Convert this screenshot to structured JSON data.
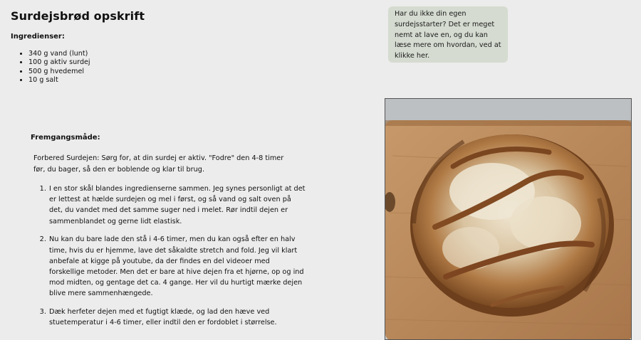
{
  "page": {
    "title": "Surdejsbrød opskrift"
  },
  "ingredients": {
    "heading": "Ingredienser:",
    "items": [
      "340 g vand (lunt)",
      "100 g aktiv surdej",
      "500 g hvedemel",
      "10 g salt"
    ]
  },
  "callout": {
    "text": "Har du ikke din egen surdejsstarter? Det er meget nemt at lave en, og du kan læse mere om hvordan, ved at klikke her."
  },
  "method": {
    "heading": "Fremgangsmåde:",
    "intro": "Forbered Surdejen: Sørg for, at din surdej er aktiv. \"Fodre\" den 4-8 timer før, du bager, så den er boblende og klar til brug.",
    "steps": [
      "I en stor skål blandes ingredienserne sammen. Jeg synes personligt at det er lettest at hælde surdejen og mel i først, og så vand og salt oven på det, du vandet med det samme suger ned i melet. Rør indtil dejen er sammenblandet og gerne lidt elastisk.",
      "Nu kan du bare lade den stå i 4-6 timer, men du kan også efter en halv time, hvis du er hjemme, lave det såkaldte stretch and fold. Jeg vil klart anbefale at kigge på youtube, da der findes en del videoer med forskellige metoder. Men det er bare at hive dejen fra et hjørne, op og ind mod midten, og gentage det ca. 4 gange. Her vil du hurtigt mærke dejen blive mere sammenhængede.",
      "Dæk herfeter dejen med et fugtigt klæde, og lad den hæve ved stuetemperatur i 4-6 timer, eller indtil den er fordoblet i størrelse."
    ]
  },
  "colors": {
    "background": "#ececec",
    "callout_bg": "#d5dbd0",
    "board": "#b9895a",
    "crust": "#a66e3c",
    "flour": "#eee3cc"
  }
}
